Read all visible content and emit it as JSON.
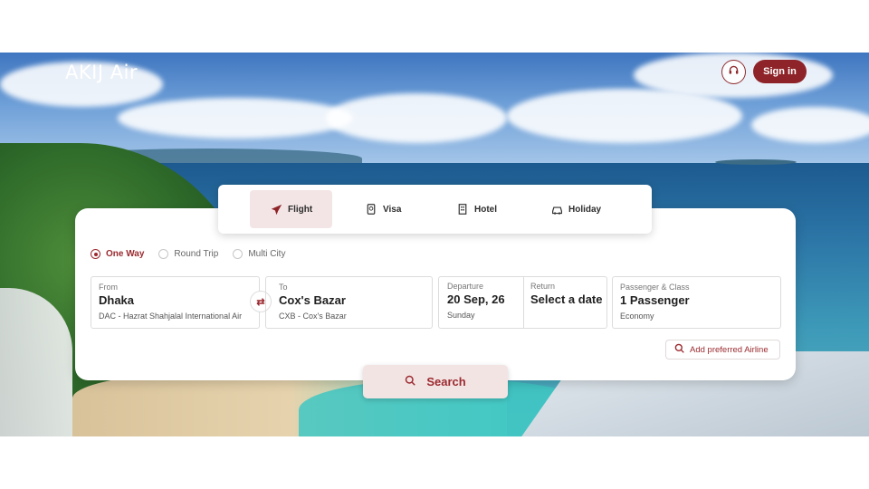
{
  "header": {
    "logo": "AKIJ Air",
    "support_icon": "headset-icon",
    "signin_label": "Sign in"
  },
  "colors": {
    "brand": "#8e2429",
    "tab_active_bg": "#f3e5e5",
    "page_bg": "#ffffff"
  },
  "tabs": [
    {
      "label": "Flight",
      "icon": "airplane-icon",
      "active": true
    },
    {
      "label": "Visa",
      "icon": "passport-icon",
      "active": false
    },
    {
      "label": "Hotel",
      "icon": "building-icon",
      "active": false
    },
    {
      "label": "Holiday",
      "icon": "car-icon",
      "active": false
    }
  ],
  "trip_types": [
    {
      "label": "One Way",
      "selected": true
    },
    {
      "label": "Round Trip",
      "selected": false
    },
    {
      "label": "Multi City",
      "selected": false
    }
  ],
  "from": {
    "label": "From",
    "city": "Dhaka",
    "airport": "DAC - Hazrat Shahjalal International Air"
  },
  "to": {
    "label": "To",
    "city": "Cox's Bazar",
    "airport": "CXB - Cox's Bazar"
  },
  "departure": {
    "label": "Departure",
    "date": "20 Sep, 26",
    "day": "Sunday"
  },
  "return": {
    "label": "Return",
    "value": "Select a date"
  },
  "passenger": {
    "label": "Passenger & Class",
    "count": "1 Passenger",
    "class": "Economy"
  },
  "airline": {
    "label": "Add preferred Airline"
  },
  "search": {
    "label": "Search"
  }
}
